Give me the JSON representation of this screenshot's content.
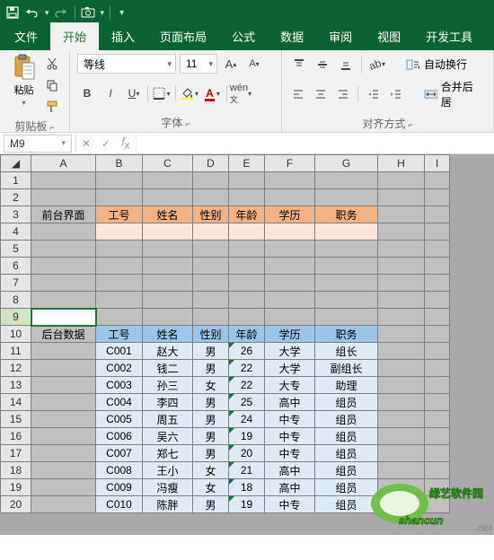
{
  "tabs": [
    "文件",
    "开始",
    "插入",
    "页面布局",
    "公式",
    "数据",
    "审阅",
    "视图",
    "开发工具"
  ],
  "active_tab": 1,
  "ribbon": {
    "paste": "粘贴",
    "clipboard": "剪贴板",
    "font_name": "等线",
    "font_size": "11",
    "font_group": "字体",
    "align_group": "对齐方式",
    "wrap": "自动换行",
    "merge": "合并后居"
  },
  "namebox": "M9",
  "cols": [
    "A",
    "B",
    "C",
    "D",
    "E",
    "F",
    "G",
    "H",
    "I"
  ],
  "rows_count": 20,
  "cells": {
    "A3": "前台界面",
    "B3": "工号",
    "C3": "姓名",
    "D3": "性别",
    "E3": "年龄",
    "F3": "学历",
    "G3": "职务",
    "A10": "后台数据",
    "B10": "工号",
    "C10": "姓名",
    "D10": "性别",
    "E10": "年龄",
    "F10": "学历",
    "G10": "职务",
    "B11": "C001",
    "C11": "赵大",
    "D11": "男",
    "E11": "26",
    "F11": "大学",
    "G11": "组长",
    "B12": "C002",
    "C12": "钱二",
    "D12": "男",
    "E12": "22",
    "F12": "大学",
    "G12": "副组长",
    "B13": "C003",
    "C13": "孙三",
    "D13": "女",
    "E13": "22",
    "F13": "大专",
    "G13": "助理",
    "B14": "C004",
    "C14": "李四",
    "D14": "男",
    "E14": "25",
    "F14": "高中",
    "G14": "组员",
    "B15": "C005",
    "C15": "周五",
    "D15": "男",
    "E15": "24",
    "F15": "中专",
    "G15": "组员",
    "B16": "C006",
    "C16": "吴六",
    "D16": "男",
    "E16": "19",
    "F16": "中专",
    "G16": "组员",
    "B17": "C007",
    "C17": "郑七",
    "D17": "男",
    "E17": "20",
    "F17": "中专",
    "G17": "组员",
    "B18": "C008",
    "C18": "王小",
    "D18": "女",
    "E18": "21",
    "F18": "高中",
    "G18": "组员",
    "B19": "C009",
    "C19": "冯瘦",
    "D19": "女",
    "E19": "18",
    "F19": "高中",
    "G19": "组员",
    "B20": "C010",
    "C20": "陈胖",
    "D20": "男",
    "E20": "19",
    "F20": "中专",
    "G20": "组员"
  },
  "watermark": {
    "line1": "绿艺软件园",
    "line2": "shancun"
  }
}
